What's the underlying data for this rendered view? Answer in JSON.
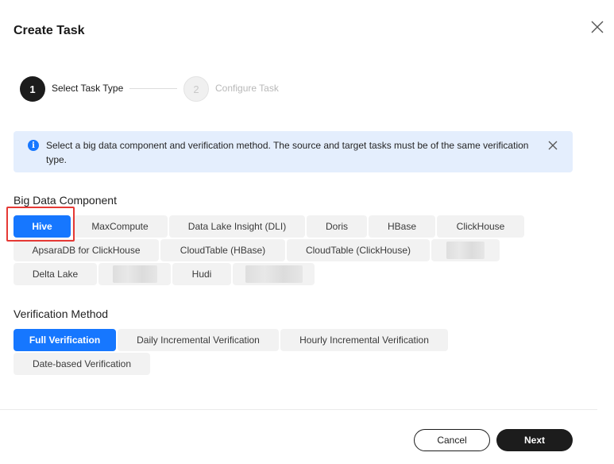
{
  "dialog": {
    "title": "Create Task"
  },
  "stepper": {
    "steps": [
      {
        "number": "1",
        "label": "Select Task Type",
        "state": "active"
      },
      {
        "number": "2",
        "label": "Configure Task",
        "state": "pending"
      }
    ]
  },
  "info": {
    "icon": "info-icon",
    "text": "Select a big data component and verification method. The source and target tasks must be of the same verification type."
  },
  "components": {
    "label": "Big Data Component",
    "selected": "Hive",
    "options": [
      "Hive",
      "MaxCompute",
      "Data Lake Insight (DLI)",
      "Doris",
      "HBase",
      "ClickHouse",
      "ApsaraDB for ClickHouse",
      "CloudTable (HBase)",
      "CloudTable (ClickHouse)",
      "Delta Lake",
      "Hudi"
    ]
  },
  "verification": {
    "label": "Verification Method",
    "selected": "Full Verification",
    "options": [
      "Full Verification",
      "Daily Incremental Verification",
      "Hourly Incremental Verification",
      "Date-based Verification"
    ]
  },
  "footer": {
    "cancel_label": "Cancel",
    "next_label": "Next"
  },
  "colors": {
    "accent": "#1677ff",
    "dark": "#1c1c1c",
    "info_bg": "#e4eefd",
    "highlight": "#e53935"
  }
}
